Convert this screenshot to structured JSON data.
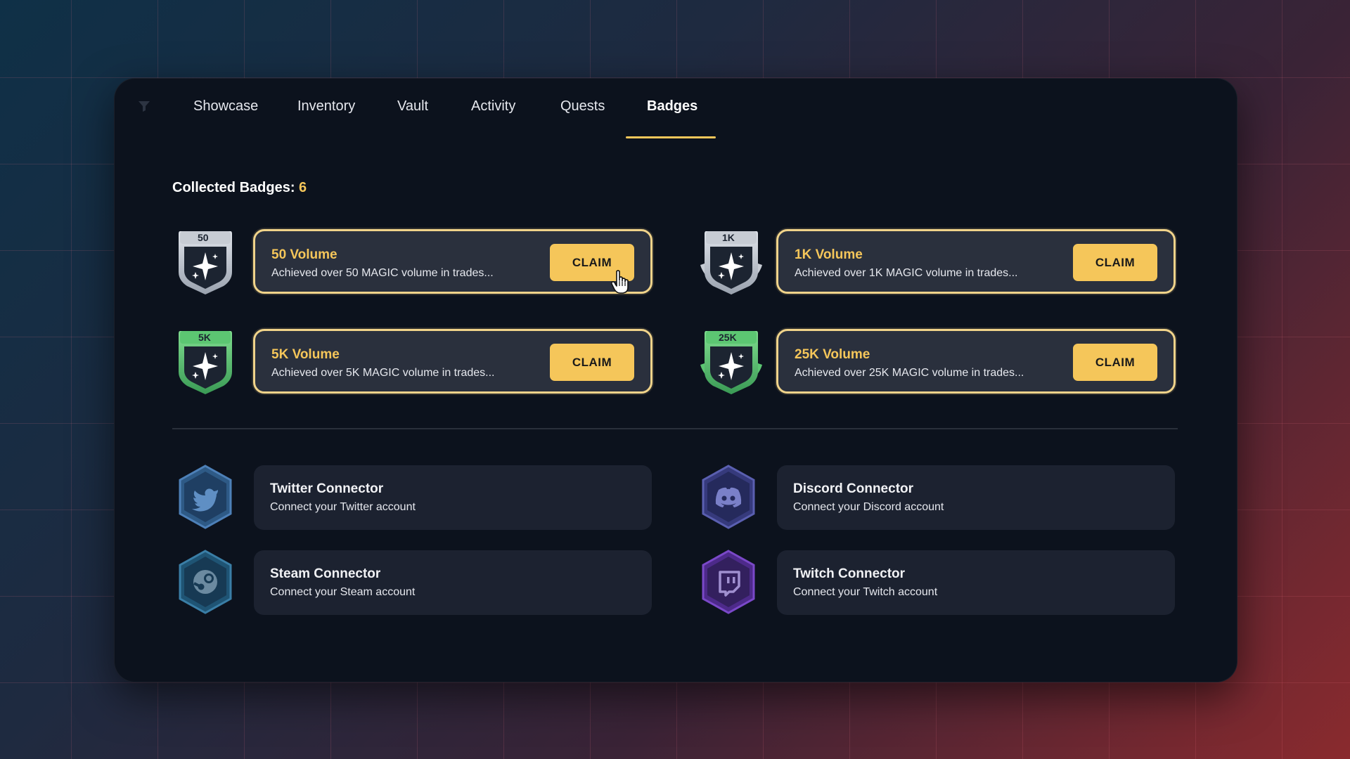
{
  "nav": {
    "tabs": [
      {
        "label": "Showcase"
      },
      {
        "label": "Inventory"
      },
      {
        "label": "Vault"
      },
      {
        "label": "Activity"
      },
      {
        "label": "Quests"
      },
      {
        "label": "Badges",
        "active": true
      }
    ]
  },
  "collected": {
    "label": "Collected Badges:",
    "count": "6"
  },
  "badges": [
    {
      "tier": "50",
      "title": "50 Volume",
      "desc": "Achieved over 50 MAGIC volume in trades...",
      "button": "CLAIM",
      "color": "silver"
    },
    {
      "tier": "1K",
      "title": "1K Volume",
      "desc": "Achieved over 1K MAGIC volume in trades...",
      "button": "CLAIM",
      "color": "silver"
    },
    {
      "tier": "5K",
      "title": "5K Volume",
      "desc": "Achieved over 5K MAGIC volume in trades...",
      "button": "CLAIM",
      "color": "green"
    },
    {
      "tier": "25K",
      "title": "25K Volume",
      "desc": "Achieved over 25K MAGIC volume in trades...",
      "button": "CLAIM",
      "color": "green"
    }
  ],
  "connectors": [
    {
      "title": "Twitter Connector",
      "desc": "Connect your Twitter account",
      "icon": "twitter-icon",
      "color": "#3f6b9e"
    },
    {
      "title": "Discord Connector",
      "desc": "Connect your Discord account",
      "icon": "discord-icon",
      "color": "#4a4f96"
    },
    {
      "title": "Steam Connector",
      "desc": "Connect your Steam account",
      "icon": "steam-icon",
      "color": "#2f6a8e"
    },
    {
      "title": "Twitch Connector",
      "desc": "Connect your Twitch account",
      "icon": "twitch-icon",
      "color": "#6a3aa8"
    }
  ],
  "colors": {
    "accent": "#f5c65a",
    "background": "#0c121d",
    "card": "#2a303d"
  }
}
